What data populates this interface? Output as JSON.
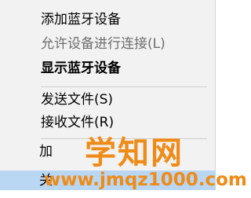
{
  "menu": {
    "items": [
      {
        "label": "添加蓝牙设备",
        "state": "normal"
      },
      {
        "label": "允许设备进行连接(L)",
        "state": "disabled"
      },
      {
        "label": "显示蓝牙设备",
        "state": "bold"
      },
      {
        "label": "发送文件(S)",
        "state": "normal"
      },
      {
        "label": "接收文件(R)",
        "state": "normal"
      }
    ],
    "partial_labels": [
      "加",
      "关"
    ]
  },
  "watermark": {
    "title": "学知网",
    "url": "www.jmqz1000.com",
    "color": "#ef8b16"
  },
  "colors": {
    "menu_background": "#f2f2f2",
    "highlight": "#b9d6f3",
    "disabled_text": "#6d6d6d"
  }
}
